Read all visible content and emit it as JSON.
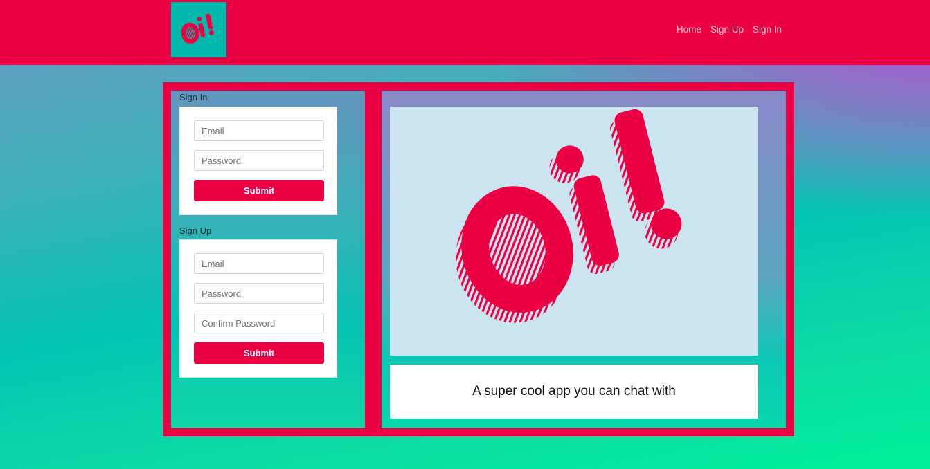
{
  "brand": {
    "logo_text": "Oi!"
  },
  "nav": {
    "links": [
      "Home",
      "Sign Up",
      "Sign In"
    ]
  },
  "sign_in": {
    "title": "Sign In",
    "email_placeholder": "Email",
    "password_placeholder": "Password",
    "submit_label": "Submit"
  },
  "sign_up": {
    "title": "Sign Up",
    "email_placeholder": "Email",
    "password_placeholder": "Password",
    "confirm_placeholder": "Confirm Password",
    "submit_label": "Submit"
  },
  "hero": {
    "logo_text": "Oi!"
  },
  "tagline": "A super cool app you can chat with",
  "colors": {
    "brand_red": "#ec0044",
    "logo_bg_teal": "#02b8ac",
    "hero_bg": "#cce3f0"
  }
}
